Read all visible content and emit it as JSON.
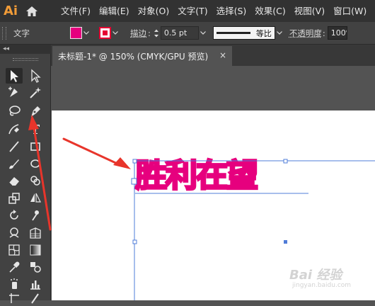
{
  "app": {
    "logo": "Ai",
    "home_icon": "home-icon"
  },
  "menu": [
    "文件(F)",
    "编辑(E)",
    "对象(O)",
    "文字(T)",
    "选择(S)",
    "效果(C)",
    "视图(V)",
    "窗口(W)"
  ],
  "control_bar": {
    "context_label": "文字",
    "fill_color": "#e6007e",
    "stroke_color": "#e60033",
    "stroke_label": "描边",
    "stroke_weight": "0.5 pt",
    "profile_label": "等比",
    "opacity_label": "不透明度",
    "opacity_value": "100%"
  },
  "toolbar": {
    "collapse_glyph": "◂◂"
  },
  "document": {
    "tab_title": "未标题-1* @ 150% (CMYK/GPU 预览)",
    "close_glyph": "×"
  },
  "artwork": {
    "text": "胜利在望",
    "color": "#e6007e"
  },
  "annotation_arrow_color": "#e8352b",
  "watermark": {
    "main": "Bai 经验",
    "sub": "jingyan.baidu.com"
  }
}
